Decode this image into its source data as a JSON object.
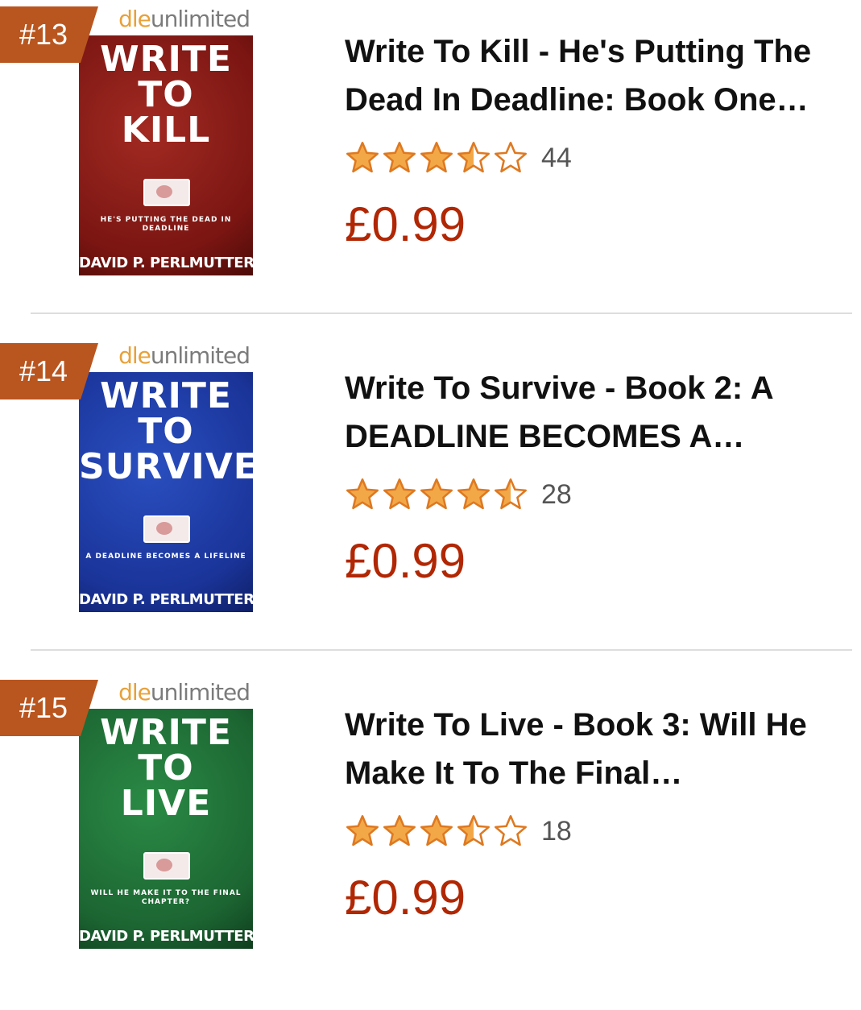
{
  "products": [
    {
      "rank": "#13",
      "title": "Write To Kill - He's Putting The Dead In Deadline: Book One…",
      "rating": 3.5,
      "review_count": "44",
      "price": "£0.99",
      "cover": {
        "badge_part1": "dle",
        "badge_part2": "unlimited",
        "line1": "WRITE",
        "line2": "TO",
        "line3": "KILL",
        "tagline": "HE'S PUTTING THE DEAD IN DEADLINE",
        "author": "DAVID P. PERLMUTTER",
        "color": "#8e1f1a"
      }
    },
    {
      "rank": "#14",
      "title": "Write To Survive - Book 2: A DEADLINE BECOMES A…",
      "rating": 4.5,
      "review_count": "28",
      "price": "£0.99",
      "cover": {
        "badge_part1": "dle",
        "badge_part2": "unlimited",
        "line1": "WRITE",
        "line2": "TO",
        "line3": "SURVIVE",
        "tagline": "A DEADLINE BECOMES A LIFELINE",
        "author": "DAVID P. PERLMUTTER",
        "color": "#1c3ea2"
      }
    },
    {
      "rank": "#15",
      "title": "Write To Live - Book 3: Will He Make It To The Final…",
      "rating": 3.5,
      "review_count": "18",
      "price": "£0.99",
      "cover": {
        "badge_part1": "dle",
        "badge_part2": "unlimited",
        "line1": "WRITE",
        "line2": "TO",
        "line3": "LIVE",
        "tagline": "WILL HE MAKE IT TO THE FINAL CHAPTER?",
        "author": "DAVID P. PERLMUTTER",
        "color": "#1f6b33"
      }
    }
  ],
  "colors": {
    "rank_badge": "#b9561f",
    "star_fill": "#f3a847",
    "star_outline": "#de7921",
    "price": "#b12704"
  }
}
